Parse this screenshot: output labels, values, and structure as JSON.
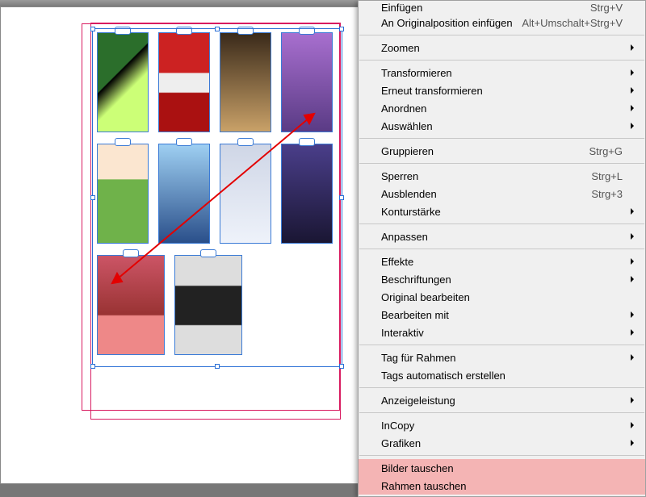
{
  "menu": {
    "items": [
      {
        "label": "Einfügen",
        "shortcut": "Strg+V",
        "sub": false,
        "dis": false,
        "hl": false,
        "cut": true
      },
      {
        "label": "An Originalposition einfügen",
        "shortcut": "Alt+Umschalt+Strg+V",
        "sub": false,
        "dis": false,
        "hl": false
      },
      {
        "sep": true
      },
      {
        "label": "Zoomen",
        "sub": true,
        "dis": false,
        "hl": false
      },
      {
        "sep": true
      },
      {
        "label": "Transformieren",
        "sub": true,
        "dis": false,
        "hl": false
      },
      {
        "label": "Erneut transformieren",
        "sub": true,
        "dis": false,
        "hl": false
      },
      {
        "label": "Anordnen",
        "sub": true,
        "dis": false,
        "hl": false
      },
      {
        "label": "Auswählen",
        "sub": true,
        "dis": false,
        "hl": false
      },
      {
        "sep": true
      },
      {
        "label": "Gruppieren",
        "shortcut": "Strg+G",
        "sub": false,
        "dis": false,
        "hl": false
      },
      {
        "sep": true
      },
      {
        "label": "Sperren",
        "shortcut": "Strg+L",
        "sub": false,
        "dis": false,
        "hl": false
      },
      {
        "label": "Ausblenden",
        "shortcut": "Strg+3",
        "sub": false,
        "dis": false,
        "hl": false
      },
      {
        "label": "Konturstärke",
        "sub": true,
        "dis": false,
        "hl": false
      },
      {
        "sep": true
      },
      {
        "label": "Anpassen",
        "sub": true,
        "dis": false,
        "hl": false
      },
      {
        "sep": true
      },
      {
        "label": "Effekte",
        "sub": true,
        "dis": false,
        "hl": false
      },
      {
        "label": "Beschriftungen",
        "sub": true,
        "dis": false,
        "hl": false
      },
      {
        "label": "Original bearbeiten",
        "sub": false,
        "dis": false,
        "hl": false
      },
      {
        "label": "Bearbeiten mit",
        "sub": true,
        "dis": false,
        "hl": false
      },
      {
        "label": "Interaktiv",
        "sub": true,
        "dis": false,
        "hl": false
      },
      {
        "sep": true
      },
      {
        "label": "Tag für Rahmen",
        "sub": true,
        "dis": false,
        "hl": false
      },
      {
        "label": "Tags automatisch erstellen",
        "sub": false,
        "dis": false,
        "hl": false
      },
      {
        "sep": true
      },
      {
        "label": "Anzeigeleistung",
        "sub": true,
        "dis": false,
        "hl": false
      },
      {
        "sep": true
      },
      {
        "label": "InCopy",
        "sub": true,
        "dis": false,
        "hl": false
      },
      {
        "label": "Grafiken",
        "sub": true,
        "dis": false,
        "hl": false
      },
      {
        "sep": true
      },
      {
        "label": "Bilder tauschen",
        "sub": false,
        "dis": false,
        "hl": true
      },
      {
        "label": "Rahmen tauschen",
        "sub": false,
        "dis": false,
        "hl": true
      }
    ]
  },
  "canvas": {
    "frames": [
      [
        "f1",
        "f2",
        "f3",
        "f4"
      ],
      [
        "f5",
        "f6",
        "f7",
        "f8"
      ],
      [
        "f9",
        "f10"
      ]
    ]
  }
}
